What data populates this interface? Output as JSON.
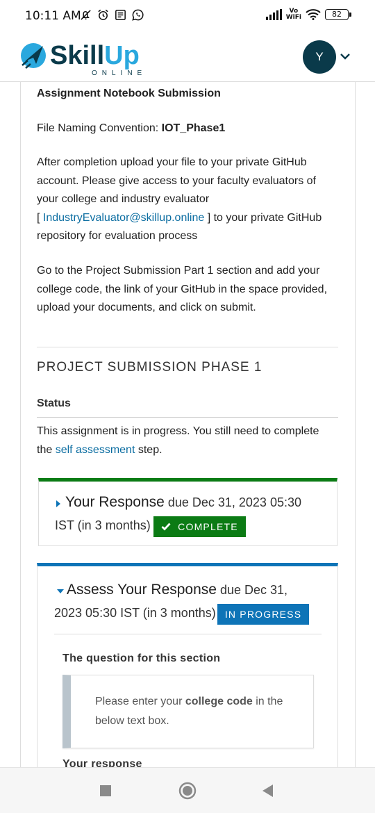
{
  "status_bar": {
    "time": "10:11 AM",
    "left_icons": [
      "mute-icon",
      "alarm-icon",
      "news-icon",
      "whatsapp-icon"
    ],
    "vo": "Vo",
    "wifi_label": "WiFi",
    "battery": "82"
  },
  "header": {
    "logo_main": "SkillUp",
    "logo_sub": "ONLINE",
    "avatar_initial": "Y",
    "brand_colors": {
      "skill": "#0a3a4a",
      "up": "#2aa8de"
    }
  },
  "assignment": {
    "heading": "Assignment Notebook Submission",
    "naming_label": "File Naming Convention: ",
    "naming_value": "IOT_Phase1",
    "para1": {
      "line1": "After completion upload your file to your private GitHub",
      "line2": "account. Please give access to your faculty evaluators of",
      "line3": "your college and industry evaluator",
      "bracket_open": "[ ",
      "email": "IndustryEvaluator@skillup.online",
      "after_email": " ] to your private GitHub",
      "line5": "repository for evaluation process"
    },
    "para2": {
      "line1": "Go to the Project Submission Part 1 section and add your",
      "line2": "college code, the link of your GitHub in the space provided,",
      "line3": "upload your documents, and click on submit."
    }
  },
  "project": {
    "title": "PROJECT SUBMISSION PHASE 1",
    "status_heading": "Status",
    "status_line1": "This assignment is in progress. You still need to complete",
    "status_prefix": "the ",
    "status_link": "self assessment",
    "status_suffix": " step."
  },
  "steps": [
    {
      "title": "Your Response",
      "due_line1": " due Dec 31, 2023 05:30",
      "due_line2": "IST (in 3 months)",
      "badge": "COMPLETE",
      "color": "#0b7b14"
    },
    {
      "title": "Assess Your Response",
      "due_line1": " due Dec 31,",
      "due_line2": "2023 05:30 IST (in 3 months)",
      "badge": "IN PROGRESS",
      "color": "#0e74b7",
      "question_heading": "The question for this section",
      "question_pre": "Please enter your ",
      "question_bold": "college code",
      "question_post": " in the",
      "question_line2": "below text box.",
      "response_heading": "Your response"
    }
  ],
  "navbar": {
    "buttons": [
      "recent-apps-icon",
      "home-icon",
      "back-icon"
    ]
  }
}
